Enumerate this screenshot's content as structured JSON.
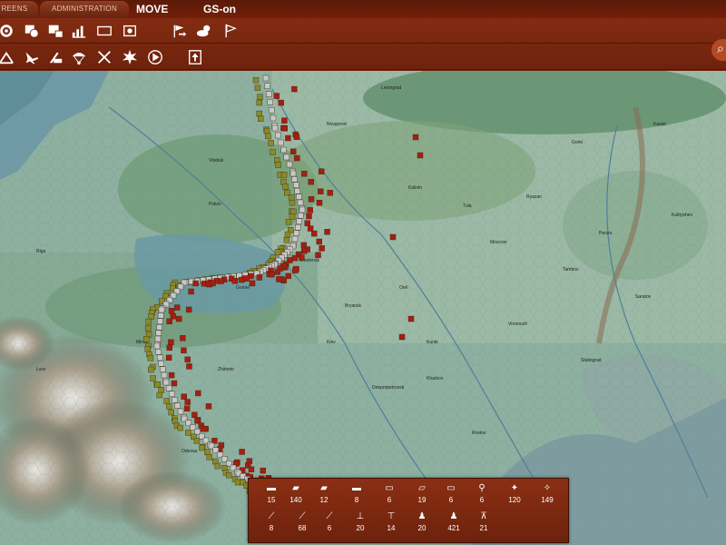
{
  "topbar": {
    "tabs": [
      "REENS",
      "ADMINISTRATION"
    ],
    "mode_label": "MOVE",
    "gs_label": "GS-on",
    "row1_icons": [
      "gear-icon",
      "unit-circle-icon",
      "factory-icon",
      "chart-icon",
      "rectangle-icon",
      "settings-frame-icon",
      "flag-arrow-icon",
      "weather-icon",
      "flag-icon"
    ],
    "row2_icons": [
      "supply-icon",
      "air-icon",
      "rail-icon",
      "paradrop-icon",
      "strike-icon",
      "explosion-icon",
      "play-circle-icon",
      "up-arrow-box-icon"
    ],
    "corner_icon": "zoom-icon"
  },
  "map": {
    "cities": [
      "Pskov",
      "Riga",
      "Novgorod",
      "Leningrad",
      "Moscow",
      "Kalinin",
      "Minsk",
      "Smolensk",
      "Bryansk",
      "Kursk",
      "Orel",
      "Voronezh",
      "Kharkov",
      "Kiev",
      "Dnepropetrovsk",
      "Stalingrad",
      "Rostov",
      "Saratov",
      "Tambov",
      "Tula",
      "Ryazan",
      "Gorki",
      "Kazan",
      "Kuibyshev",
      "Penza",
      "Vitebsk",
      "Gomel",
      "Lvov",
      "Odessa",
      "Zhitomir"
    ],
    "colors": {
      "axis": "#8a8a2a",
      "soviet": "#a61e12",
      "front": "#c8c8c8",
      "water": "#5f8f9a"
    }
  },
  "counts": {
    "row1": [
      {
        "icon": "tank-light-icon",
        "value": "15"
      },
      {
        "icon": "tank-medium-icon",
        "value": "140"
      },
      {
        "icon": "tank-heavy-icon",
        "value": "12"
      },
      {
        "icon": "assault-gun-icon",
        "value": "8"
      },
      {
        "icon": "armored-car-icon",
        "value": "6"
      },
      {
        "icon": "halftrack-icon",
        "value": "19"
      },
      {
        "icon": "truck-icon",
        "value": "6"
      },
      {
        "icon": "motorcycle-icon",
        "value": "6"
      },
      {
        "icon": "infantry-icon",
        "value": "120"
      },
      {
        "icon": "cavalry-icon",
        "value": "149"
      }
    ],
    "row2": [
      {
        "icon": "antitank-gun-icon",
        "value": "8"
      },
      {
        "icon": "artillery-icon",
        "value": "68"
      },
      {
        "icon": "howitzer-icon",
        "value": "6"
      },
      {
        "icon": "mortar-icon",
        "value": "20"
      },
      {
        "icon": "machine-gun-icon",
        "value": "14"
      },
      {
        "icon": "engineers-icon",
        "value": "20"
      },
      {
        "icon": "rifle-squad-icon",
        "value": "421"
      },
      {
        "icon": "aa-gun-icon",
        "value": "21"
      }
    ]
  }
}
